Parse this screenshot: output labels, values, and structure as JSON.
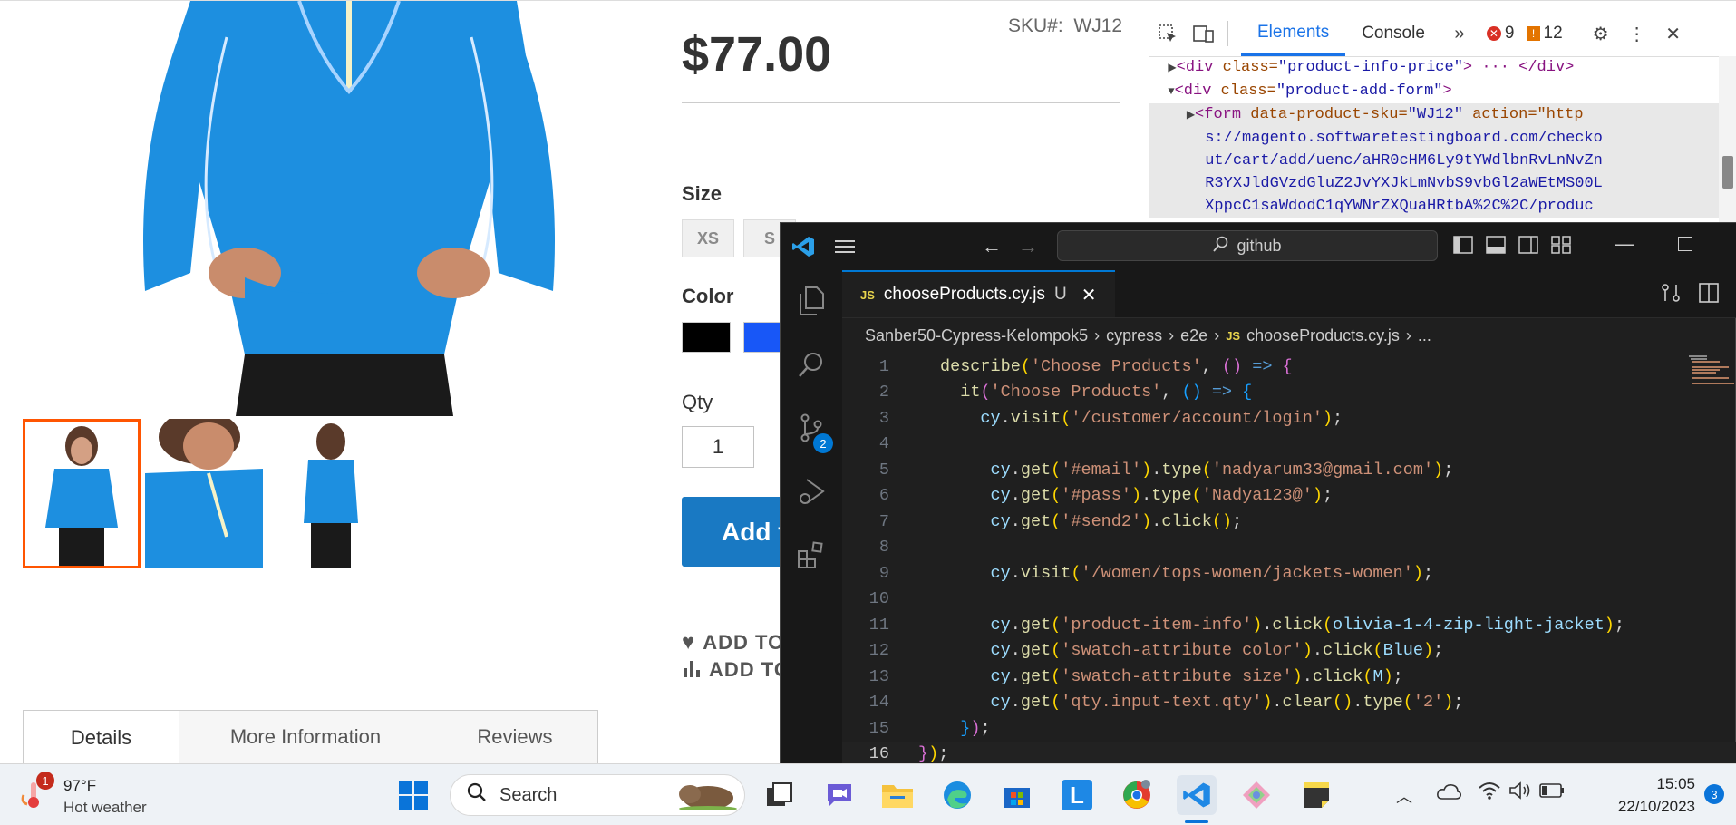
{
  "product": {
    "sku_label": "SKU#:",
    "sku_value": "WJ12",
    "price": "$77.00",
    "size_label": "Size",
    "sizes": [
      "XS",
      "S"
    ],
    "color_label": "Color",
    "colors": [
      "#000000",
      "#1857f7"
    ],
    "qty_label": "Qty",
    "qty_value": "1",
    "add_to_cart": "Add t",
    "add_to_wishlist": "ADD TO",
    "add_to_compare": "ADD TO",
    "tabs": [
      "Details",
      "More Information",
      "Reviews"
    ]
  },
  "devtools": {
    "tabs": [
      "Elements",
      "Console"
    ],
    "errors": "9",
    "warnings": "12",
    "lines": [
      {
        "indent": "  ",
        "arrow": "▶",
        "tag_open": "<div ",
        "attr": "class=",
        "val": "\"product-info-price\"",
        "rest": "> ··· </div>"
      },
      {
        "indent": "  ",
        "arrow": "▼",
        "tag_open": "<div ",
        "attr": "class=",
        "val": "\"product-add-form\"",
        "rest": ">"
      },
      {
        "indent": "    ",
        "arrow": "▶",
        "tag_open": "<form ",
        "attr": "data-product-sku=",
        "val": "\"WJ12\"",
        "rest": " action=\"http"
      },
      {
        "text": "      s://magento.softwaretestingboard.com/checko"
      },
      {
        "text": "      ut/cart/add/uenc/aHR0cHM6Ly9tYWdlbnRvLnNvZn"
      },
      {
        "text": "      R3YXJldGVzdGluZ2JvYXJkLmNvbS9vbGl2aWEtMS00L"
      },
      {
        "text": "      XppcC1saWdodC1qYWNrZXQuaHRtbA%2C%2C/produc"
      }
    ]
  },
  "vscode": {
    "search": "github",
    "tab_name": "chooseProducts.cy.js",
    "tab_status": "U",
    "breadcrumbs": [
      "Sanber50-Cypress-Kelompok5",
      "cypress",
      "e2e",
      "chooseProducts.cy.js",
      "..."
    ],
    "scm_badge": "2",
    "line_numbers": [
      "1",
      "2",
      "3",
      "4",
      "5",
      "6",
      "7",
      "8",
      "9",
      "10",
      "11",
      "12",
      "13",
      "14",
      "15",
      "16"
    ]
  },
  "taskbar": {
    "weather_temp": "97°F",
    "weather_desc": "Hot weather",
    "weather_badge": "1",
    "search_placeholder": "Search",
    "time": "15:05",
    "date": "22/10/2023",
    "notification_count": "3"
  }
}
